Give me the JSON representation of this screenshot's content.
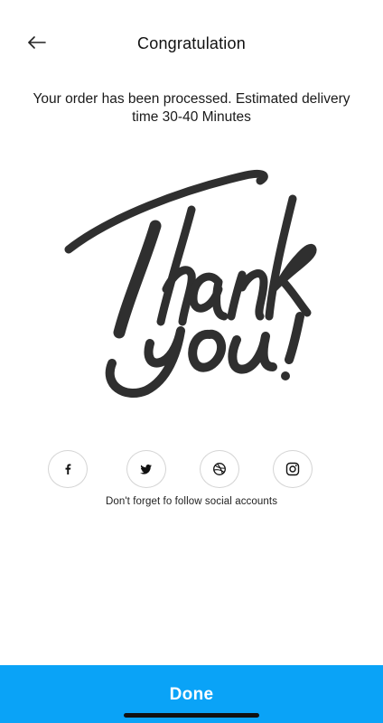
{
  "header": {
    "title": "Congratulation",
    "back_icon": "arrow-left-icon"
  },
  "message": "Your order has been processed. Estimated delivery time 30-40 Minutes",
  "illustration": {
    "text": "Thank you!",
    "color": "#2f2f2f"
  },
  "social": {
    "items": [
      {
        "icon": "facebook-icon"
      },
      {
        "icon": "twitter-icon"
      },
      {
        "icon": "dribbble-icon"
      },
      {
        "icon": "instagram-icon"
      }
    ],
    "caption": "Don't forget fo follow social accounts"
  },
  "footer": {
    "done_label": "Done",
    "color": "#0aa3f7"
  }
}
